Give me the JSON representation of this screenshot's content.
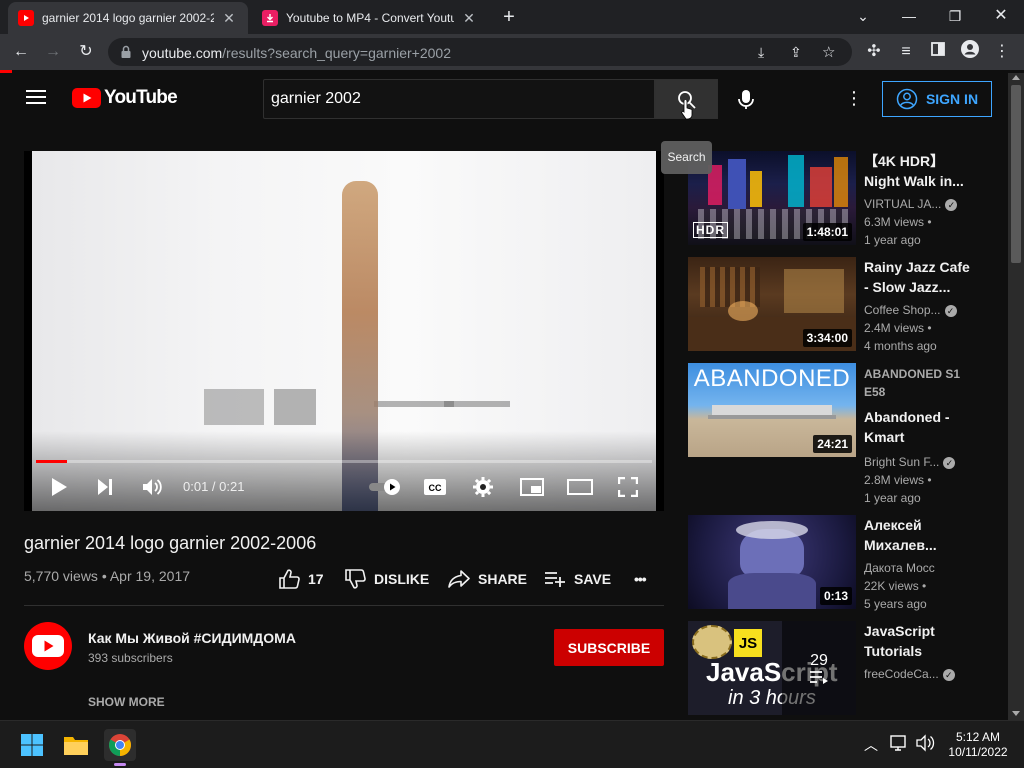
{
  "browser": {
    "tabs": [
      {
        "title": "garnier 2014 logo garnier 2002-2",
        "favicon": "youtube-favicon",
        "active": true
      },
      {
        "title": "Youtube to MP4 - Convert Youtub",
        "favicon": "download-favicon",
        "active": false
      }
    ],
    "new_tab_label": "+",
    "url_host": "youtube.com",
    "url_path": "/results?search_query=garnier+2002"
  },
  "masthead": {
    "logo_text": "YouTube",
    "search_value": "garnier 2002",
    "search_tooltip": "Search",
    "signin_label": "SIGN IN"
  },
  "player": {
    "time": "0:01 / 0:21",
    "progress_fraction": 0.05
  },
  "video": {
    "title": "garnier 2014 logo garnier 2002-2006",
    "meta": "5,770 views • Apr 19, 2017",
    "like_count": "17",
    "dislike_label": "DISLIKE",
    "share_label": "SHARE",
    "save_label": "SAVE",
    "more_label": "•••"
  },
  "channel": {
    "name": "Как Мы Живой #СИДИМДОМА",
    "subscribers": "393 subscribers",
    "subscribe_label": "SUBSCRIBE",
    "show_more": "SHOW MORE"
  },
  "recommendations": [
    {
      "title": "【4K HDR】 Night Walk in...",
      "channel": "VIRTUAL JA...",
      "views": "6.3M views •",
      "age": "1 year ago",
      "duration": "1:48:01",
      "badge": "HDR"
    },
    {
      "title": "Rainy Jazz Cafe - Slow Jazz...",
      "channel": "Coffee Shop...",
      "views": "2.4M views •",
      "age": "4 months ago",
      "duration": "3:34:00"
    },
    {
      "title": "Abandoned - Kmart",
      "top_label": "ABANDONED S1 E58",
      "channel": "Bright Sun F...",
      "views": "2.8M views •",
      "age": "1 year ago",
      "duration": "24:21",
      "thumb_text": "ABANDONED"
    },
    {
      "title": "Алексей Михалев...",
      "channel": "Дакота Мосс",
      "views": "22K views •",
      "age": "5 years ago",
      "duration": "0:13"
    },
    {
      "title": "JavaScript Tutorials",
      "channel": "freeCodeCa...",
      "playlist_count": "29",
      "thumb_line1": "JavaScript",
      "thumb_line2": "in 3 hours",
      "thumb_badge": "JS"
    }
  ],
  "taskbar": {
    "time": "5:12 AM",
    "date": "10/11/2022"
  },
  "colors": {
    "accent_red": "#ff0000",
    "subscribe_red": "#cc0000",
    "signin_blue": "#3ea6ff",
    "background": "#0f0f0f"
  }
}
